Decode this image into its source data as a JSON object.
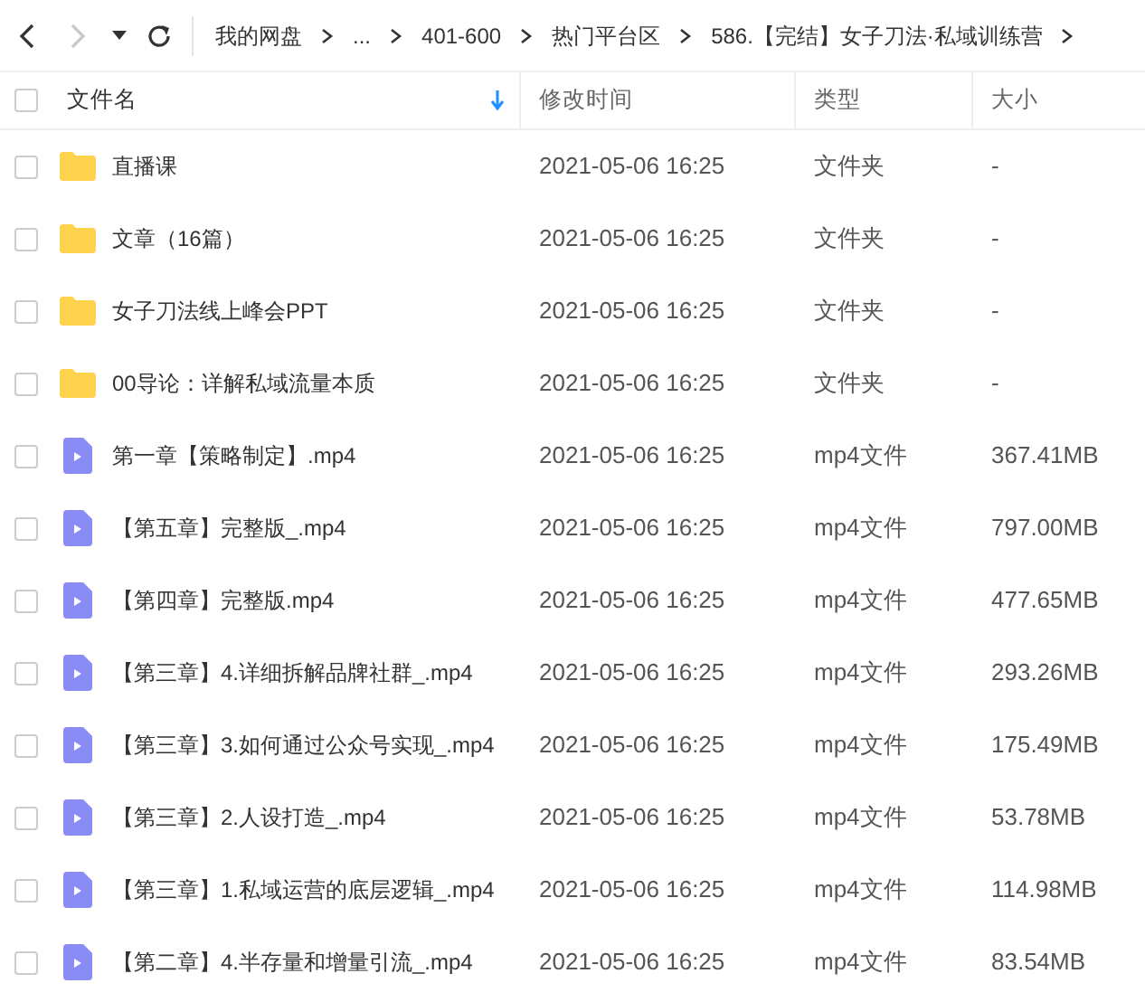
{
  "toolbar": {
    "back_disabled": false,
    "forward_disabled": true
  },
  "breadcrumb": [
    "我的网盘",
    "...",
    "401-600",
    "热门平台区",
    "586.【完结】女子刀法·私域训练营"
  ],
  "table": {
    "select_all_checked": false,
    "columns": [
      {
        "label": "文件名",
        "sorted": true
      },
      {
        "label": "修改时间",
        "sorted": false
      },
      {
        "label": "类型",
        "sorted": false
      },
      {
        "label": "大小",
        "sorted": false
      }
    ],
    "rows": [
      {
        "kind": "folder",
        "name": "直播课",
        "modified": "2021-05-06 16:25",
        "type": "文件夹",
        "size": "-",
        "checked": false
      },
      {
        "kind": "folder",
        "name": "文章（16篇）",
        "modified": "2021-05-06 16:25",
        "type": "文件夹",
        "size": "-",
        "checked": false
      },
      {
        "kind": "folder",
        "name": "女子刀法线上峰会PPT",
        "modified": "2021-05-06 16:25",
        "type": "文件夹",
        "size": "-",
        "checked": false
      },
      {
        "kind": "folder",
        "name": "00导论：详解私域流量本质",
        "modified": "2021-05-06 16:25",
        "type": "文件夹",
        "size": "-",
        "checked": false
      },
      {
        "kind": "video",
        "name": "第一章【策略制定】.mp4",
        "modified": "2021-05-06 16:25",
        "type": "mp4文件",
        "size": "367.41MB",
        "checked": false
      },
      {
        "kind": "video",
        "name": "【第五章】完整版_.mp4",
        "modified": "2021-05-06 16:25",
        "type": "mp4文件",
        "size": "797.00MB",
        "checked": false
      },
      {
        "kind": "video",
        "name": "【第四章】完整版.mp4",
        "modified": "2021-05-06 16:25",
        "type": "mp4文件",
        "size": "477.65MB",
        "checked": false
      },
      {
        "kind": "video",
        "name": "【第三章】4.详细拆解品牌社群_.mp4",
        "modified": "2021-05-06 16:25",
        "type": "mp4文件",
        "size": "293.26MB",
        "checked": false
      },
      {
        "kind": "video",
        "name": "【第三章】3.如何通过公众号实现_.mp4",
        "modified": "2021-05-06 16:25",
        "type": "mp4文件",
        "size": "175.49MB",
        "checked": false
      },
      {
        "kind": "video",
        "name": "【第三章】2.人设打造_.mp4",
        "modified": "2021-05-06 16:25",
        "type": "mp4文件",
        "size": "53.78MB",
        "checked": false
      },
      {
        "kind": "video",
        "name": "【第三章】1.私域运营的底层逻辑_.mp4",
        "modified": "2021-05-06 16:25",
        "type": "mp4文件",
        "size": "114.98MB",
        "checked": false
      },
      {
        "kind": "video",
        "name": "【第二章】4.半存量和增量引流_.mp4",
        "modified": "2021-05-06 16:25",
        "type": "mp4文件",
        "size": "83.54MB",
        "checked": false
      }
    ]
  }
}
